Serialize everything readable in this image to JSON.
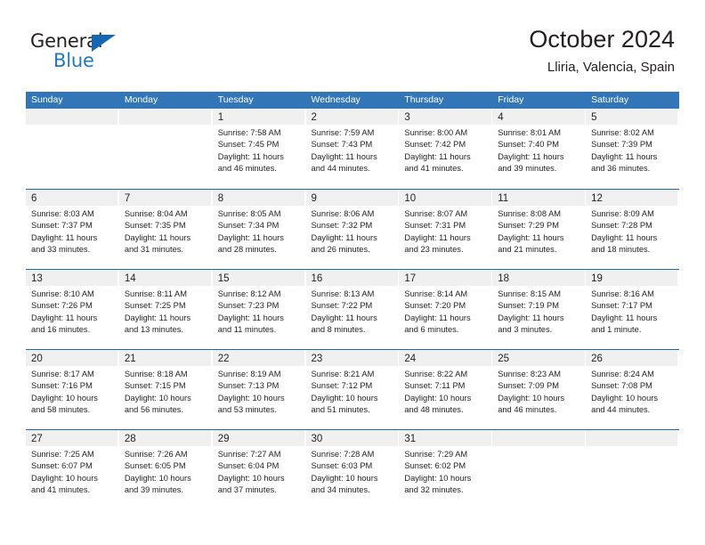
{
  "brand": {
    "name_top": "General",
    "name_bottom": "Blue",
    "accent_color": "#1f7ac4",
    "triangle_color": "#1667b2"
  },
  "header": {
    "title": "October 2024",
    "subtitle": "Lliria, Valencia, Spain"
  },
  "theme": {
    "header_band": "#3376b8",
    "row_divider": "#1f68ad",
    "day_band": "#f0f0f0",
    "text": "#231f20"
  },
  "weekdays": [
    "Sunday",
    "Monday",
    "Tuesday",
    "Wednesday",
    "Thursday",
    "Friday",
    "Saturday"
  ],
  "weeks": [
    [
      {
        "day": "",
        "sunrise": "",
        "sunset": "",
        "daylight_1": "",
        "daylight_2": ""
      },
      {
        "day": "",
        "sunrise": "",
        "sunset": "",
        "daylight_1": "",
        "daylight_2": ""
      },
      {
        "day": "1",
        "sunrise": "Sunrise: 7:58 AM",
        "sunset": "Sunset: 7:45 PM",
        "daylight_1": "Daylight: 11 hours",
        "daylight_2": "and 46 minutes."
      },
      {
        "day": "2",
        "sunrise": "Sunrise: 7:59 AM",
        "sunset": "Sunset: 7:43 PM",
        "daylight_1": "Daylight: 11 hours",
        "daylight_2": "and 44 minutes."
      },
      {
        "day": "3",
        "sunrise": "Sunrise: 8:00 AM",
        "sunset": "Sunset: 7:42 PM",
        "daylight_1": "Daylight: 11 hours",
        "daylight_2": "and 41 minutes."
      },
      {
        "day": "4",
        "sunrise": "Sunrise: 8:01 AM",
        "sunset": "Sunset: 7:40 PM",
        "daylight_1": "Daylight: 11 hours",
        "daylight_2": "and 39 minutes."
      },
      {
        "day": "5",
        "sunrise": "Sunrise: 8:02 AM",
        "sunset": "Sunset: 7:39 PM",
        "daylight_1": "Daylight: 11 hours",
        "daylight_2": "and 36 minutes."
      }
    ],
    [
      {
        "day": "6",
        "sunrise": "Sunrise: 8:03 AM",
        "sunset": "Sunset: 7:37 PM",
        "daylight_1": "Daylight: 11 hours",
        "daylight_2": "and 33 minutes."
      },
      {
        "day": "7",
        "sunrise": "Sunrise: 8:04 AM",
        "sunset": "Sunset: 7:35 PM",
        "daylight_1": "Daylight: 11 hours",
        "daylight_2": "and 31 minutes."
      },
      {
        "day": "8",
        "sunrise": "Sunrise: 8:05 AM",
        "sunset": "Sunset: 7:34 PM",
        "daylight_1": "Daylight: 11 hours",
        "daylight_2": "and 28 minutes."
      },
      {
        "day": "9",
        "sunrise": "Sunrise: 8:06 AM",
        "sunset": "Sunset: 7:32 PM",
        "daylight_1": "Daylight: 11 hours",
        "daylight_2": "and 26 minutes."
      },
      {
        "day": "10",
        "sunrise": "Sunrise: 8:07 AM",
        "sunset": "Sunset: 7:31 PM",
        "daylight_1": "Daylight: 11 hours",
        "daylight_2": "and 23 minutes."
      },
      {
        "day": "11",
        "sunrise": "Sunrise: 8:08 AM",
        "sunset": "Sunset: 7:29 PM",
        "daylight_1": "Daylight: 11 hours",
        "daylight_2": "and 21 minutes."
      },
      {
        "day": "12",
        "sunrise": "Sunrise: 8:09 AM",
        "sunset": "Sunset: 7:28 PM",
        "daylight_1": "Daylight: 11 hours",
        "daylight_2": "and 18 minutes."
      }
    ],
    [
      {
        "day": "13",
        "sunrise": "Sunrise: 8:10 AM",
        "sunset": "Sunset: 7:26 PM",
        "daylight_1": "Daylight: 11 hours",
        "daylight_2": "and 16 minutes."
      },
      {
        "day": "14",
        "sunrise": "Sunrise: 8:11 AM",
        "sunset": "Sunset: 7:25 PM",
        "daylight_1": "Daylight: 11 hours",
        "daylight_2": "and 13 minutes."
      },
      {
        "day": "15",
        "sunrise": "Sunrise: 8:12 AM",
        "sunset": "Sunset: 7:23 PM",
        "daylight_1": "Daylight: 11 hours",
        "daylight_2": "and 11 minutes."
      },
      {
        "day": "16",
        "sunrise": "Sunrise: 8:13 AM",
        "sunset": "Sunset: 7:22 PM",
        "daylight_1": "Daylight: 11 hours",
        "daylight_2": "and 8 minutes."
      },
      {
        "day": "17",
        "sunrise": "Sunrise: 8:14 AM",
        "sunset": "Sunset: 7:20 PM",
        "daylight_1": "Daylight: 11 hours",
        "daylight_2": "and 6 minutes."
      },
      {
        "day": "18",
        "sunrise": "Sunrise: 8:15 AM",
        "sunset": "Sunset: 7:19 PM",
        "daylight_1": "Daylight: 11 hours",
        "daylight_2": "and 3 minutes."
      },
      {
        "day": "19",
        "sunrise": "Sunrise: 8:16 AM",
        "sunset": "Sunset: 7:17 PM",
        "daylight_1": "Daylight: 11 hours",
        "daylight_2": "and 1 minute."
      }
    ],
    [
      {
        "day": "20",
        "sunrise": "Sunrise: 8:17 AM",
        "sunset": "Sunset: 7:16 PM",
        "daylight_1": "Daylight: 10 hours",
        "daylight_2": "and 58 minutes."
      },
      {
        "day": "21",
        "sunrise": "Sunrise: 8:18 AM",
        "sunset": "Sunset: 7:15 PM",
        "daylight_1": "Daylight: 10 hours",
        "daylight_2": "and 56 minutes."
      },
      {
        "day": "22",
        "sunrise": "Sunrise: 8:19 AM",
        "sunset": "Sunset: 7:13 PM",
        "daylight_1": "Daylight: 10 hours",
        "daylight_2": "and 53 minutes."
      },
      {
        "day": "23",
        "sunrise": "Sunrise: 8:21 AM",
        "sunset": "Sunset: 7:12 PM",
        "daylight_1": "Daylight: 10 hours",
        "daylight_2": "and 51 minutes."
      },
      {
        "day": "24",
        "sunrise": "Sunrise: 8:22 AM",
        "sunset": "Sunset: 7:11 PM",
        "daylight_1": "Daylight: 10 hours",
        "daylight_2": "and 48 minutes."
      },
      {
        "day": "25",
        "sunrise": "Sunrise: 8:23 AM",
        "sunset": "Sunset: 7:09 PM",
        "daylight_1": "Daylight: 10 hours",
        "daylight_2": "and 46 minutes."
      },
      {
        "day": "26",
        "sunrise": "Sunrise: 8:24 AM",
        "sunset": "Sunset: 7:08 PM",
        "daylight_1": "Daylight: 10 hours",
        "daylight_2": "and 44 minutes."
      }
    ],
    [
      {
        "day": "27",
        "sunrise": "Sunrise: 7:25 AM",
        "sunset": "Sunset: 6:07 PM",
        "daylight_1": "Daylight: 10 hours",
        "daylight_2": "and 41 minutes."
      },
      {
        "day": "28",
        "sunrise": "Sunrise: 7:26 AM",
        "sunset": "Sunset: 6:05 PM",
        "daylight_1": "Daylight: 10 hours",
        "daylight_2": "and 39 minutes."
      },
      {
        "day": "29",
        "sunrise": "Sunrise: 7:27 AM",
        "sunset": "Sunset: 6:04 PM",
        "daylight_1": "Daylight: 10 hours",
        "daylight_2": "and 37 minutes."
      },
      {
        "day": "30",
        "sunrise": "Sunrise: 7:28 AM",
        "sunset": "Sunset: 6:03 PM",
        "daylight_1": "Daylight: 10 hours",
        "daylight_2": "and 34 minutes."
      },
      {
        "day": "31",
        "sunrise": "Sunrise: 7:29 AM",
        "sunset": "Sunset: 6:02 PM",
        "daylight_1": "Daylight: 10 hours",
        "daylight_2": "and 32 minutes."
      },
      {
        "day": "",
        "sunrise": "",
        "sunset": "",
        "daylight_1": "",
        "daylight_2": ""
      },
      {
        "day": "",
        "sunrise": "",
        "sunset": "",
        "daylight_1": "",
        "daylight_2": ""
      }
    ]
  ]
}
